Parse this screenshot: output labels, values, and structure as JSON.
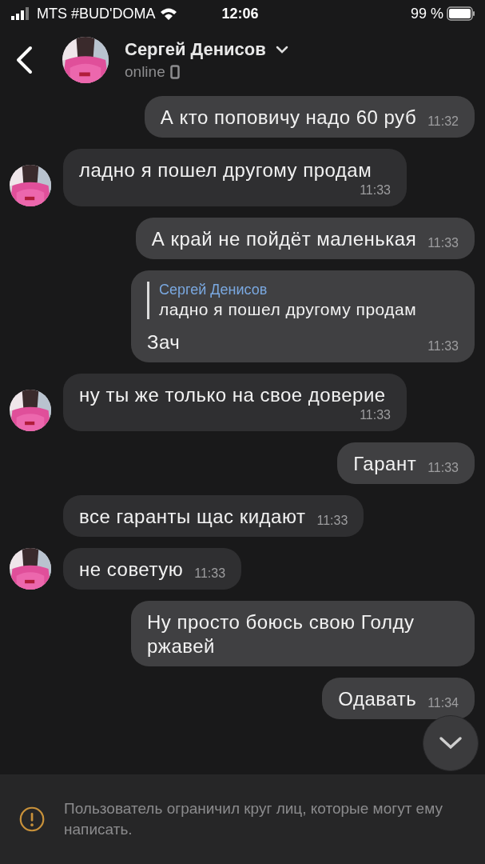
{
  "status_bar": {
    "carrier": "MTS #BUD'DOMA",
    "time": "12:06",
    "battery": "99 %"
  },
  "header": {
    "name": "Сергей Денисов",
    "status": "online"
  },
  "messages": [
    {
      "kind": "text",
      "outgoing": true,
      "text": "А кто поповичу надо 60 руб",
      "time": "11:32"
    },
    {
      "kind": "text",
      "outgoing": false,
      "avatar": true,
      "text": "ладно я пошел другому продам",
      "time": "11:33"
    },
    {
      "kind": "text",
      "outgoing": true,
      "text": "А край не пойдёт маленькая",
      "time": "11:33"
    },
    {
      "kind": "reply",
      "outgoing": true,
      "quote_author": "Сергей Денисов",
      "quote_text": "ладно я пошел другому продам",
      "text": "Зач",
      "time": "11:33"
    },
    {
      "kind": "text",
      "outgoing": false,
      "avatar": true,
      "text": "ну ты же только на свое доверие",
      "time": "11:33"
    },
    {
      "kind": "text",
      "outgoing": true,
      "text": "Гарант",
      "time": "11:33"
    },
    {
      "kind": "text",
      "outgoing": false,
      "avatar": false,
      "text": "все гаранты щас кидают",
      "time": "11:33"
    },
    {
      "kind": "text",
      "outgoing": false,
      "avatar": true,
      "text": "не советую",
      "time": "11:33"
    },
    {
      "kind": "text",
      "outgoing": true,
      "text": "Ну просто боюсь свою Голду ржавей"
    },
    {
      "kind": "text",
      "outgoing": true,
      "text": "Одавать",
      "time": "11:34"
    }
  ],
  "notice": {
    "text": "Пользователь ограничил круг лиц, которые могут ему написать."
  }
}
